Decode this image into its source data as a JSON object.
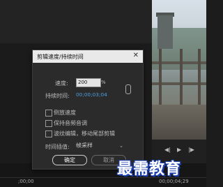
{
  "dialog": {
    "title": "剪辑速度/持续时间",
    "close_glyph": "✕",
    "speed_label": "速度:",
    "speed_value": "200",
    "speed_unit": "%",
    "duration_label": "持续时间:",
    "duration_value": "00;00;03;04",
    "options": [
      {
        "label": "倒放速度",
        "checked": false
      },
      {
        "label": "保持音频音调",
        "checked": false
      },
      {
        "label": "波纹编辑，移动尾部剪辑",
        "checked": false
      }
    ],
    "interpolation_label": "时间插值:",
    "interpolation_value": "帧采样",
    "ok_label": "确定",
    "cancel_label": "取消"
  },
  "timeline": {
    "left_timecode": ";00;00",
    "right_timecode": "00;00;04;29"
  },
  "watermark": "最需教育",
  "icons": [
    "close-icon",
    "link-icon",
    "chevron-down-icon"
  ],
  "colors": {
    "duration_text": "#4ea3e6",
    "titlebar": "#e9e9e9",
    "watermark_outline": "#1b3fb0"
  }
}
